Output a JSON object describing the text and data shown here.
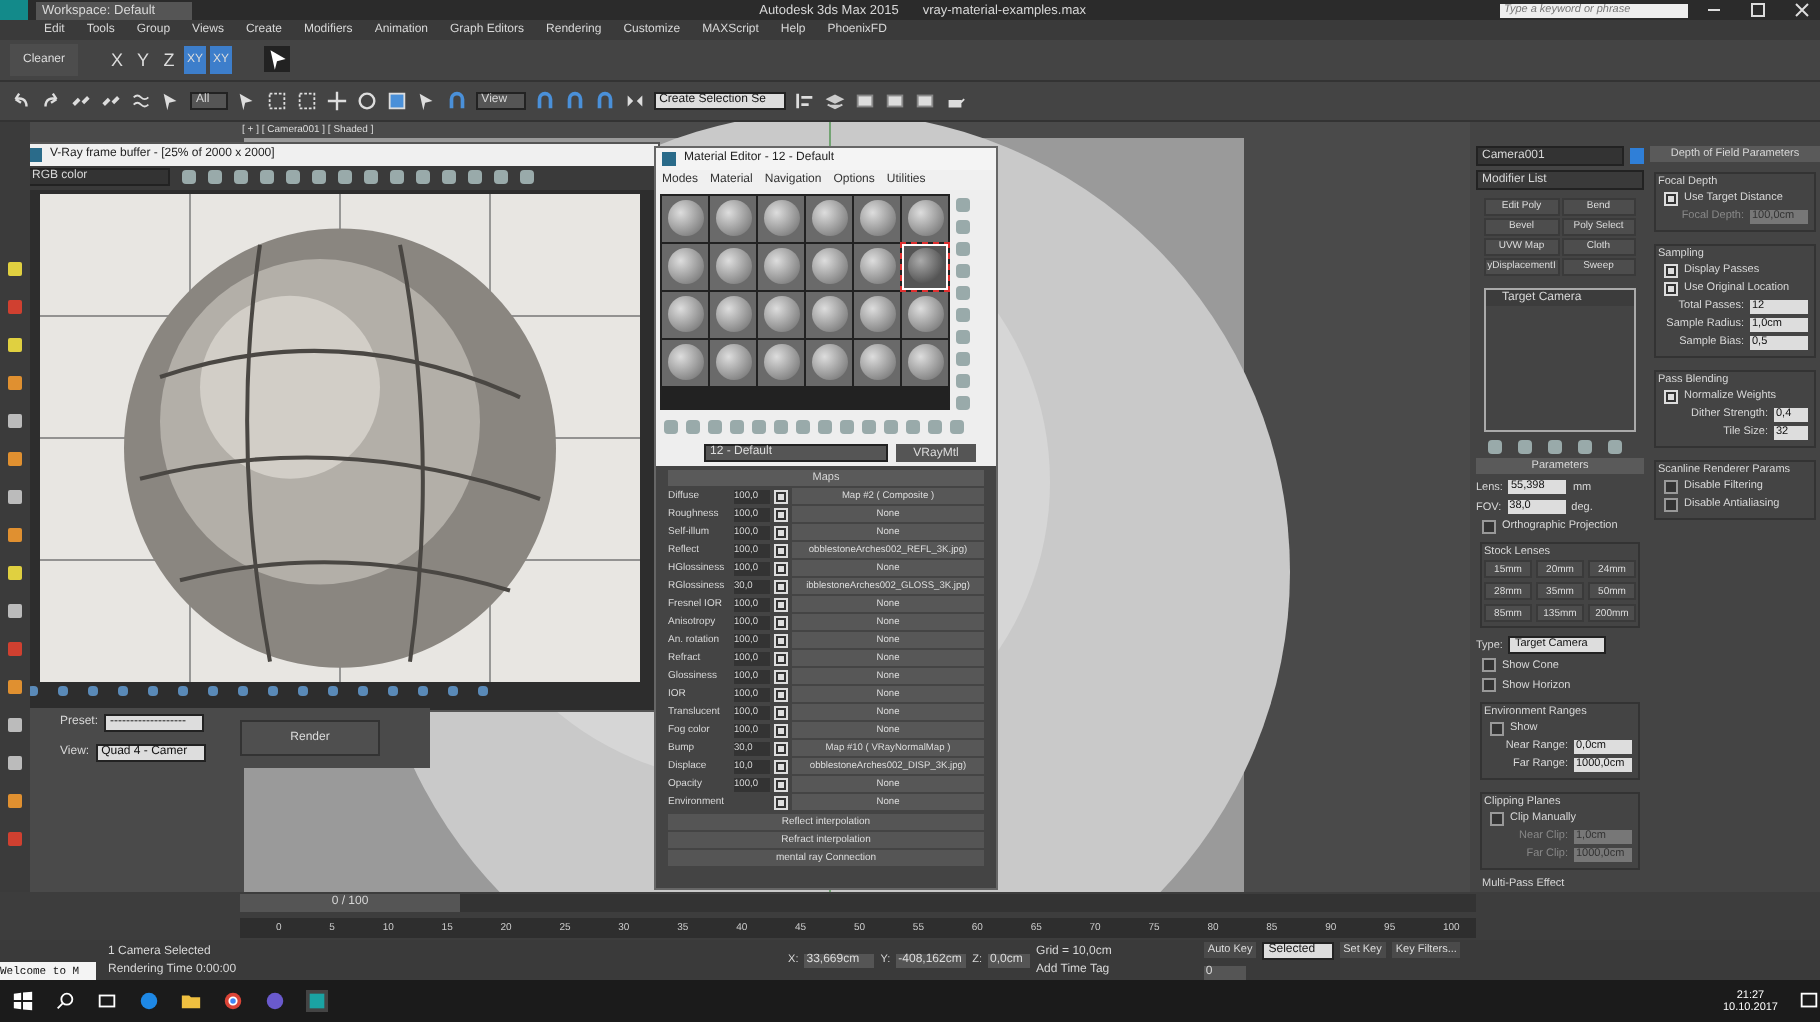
{
  "window": {
    "title": "Autodesk 3ds Max 2015",
    "file": "vray-material-examples.max",
    "workspace": "Workspace: Default",
    "search": {
      "placeholder": "Type a keyword or phrase"
    }
  },
  "menu": [
    "Edit",
    "Tools",
    "Group",
    "Views",
    "Create",
    "Modifiers",
    "Animation",
    "Graph Editors",
    "Rendering",
    "Customize",
    "MAXScript",
    "Help",
    "PhoenixFD"
  ],
  "ribbon": {
    "cleaner": "Cleaner",
    "axes": [
      {
        "label": "X",
        "selected": false
      },
      {
        "label": "Y",
        "selected": false
      },
      {
        "label": "Z",
        "selected": false
      },
      {
        "label": "XY",
        "selected": true
      },
      {
        "label": "XY",
        "selected": true
      }
    ]
  },
  "toolbar": {
    "filter": "All",
    "coord": "View",
    "selection_set": "Create Selection Se"
  },
  "viewport": {
    "label": "[ + ] [ Camera001 ] [ Shaded ]"
  },
  "frame_buffer": {
    "title": "V-Ray frame buffer - [25% of 2000 x 2000]",
    "channel": "RGB color"
  },
  "render_setup": {
    "preset_label": "Preset:",
    "preset": "-------------------",
    "view_label": "View:",
    "view": "Quad 4 - Camer",
    "render": "Render"
  },
  "material_editor": {
    "title": "Material Editor - 12 - Default",
    "menu": [
      "Modes",
      "Material",
      "Navigation",
      "Options",
      "Utilities"
    ],
    "slots": [
      {
        "selected": false
      },
      {
        "selected": false
      },
      {
        "selected": false
      },
      {
        "selected": false
      },
      {
        "selected": false
      },
      {
        "selected": false
      },
      {
        "selected": false
      },
      {
        "selected": false
      },
      {
        "selected": false
      },
      {
        "selected": false
      },
      {
        "selected": false
      },
      {
        "selected": true
      },
      {
        "selected": false
      },
      {
        "selected": false
      },
      {
        "selected": false
      },
      {
        "selected": false
      },
      {
        "selected": false
      },
      {
        "selected": false
      },
      {
        "selected": false
      },
      {
        "selected": false
      },
      {
        "selected": false
      },
      {
        "selected": false
      },
      {
        "selected": false
      },
      {
        "selected": false
      }
    ],
    "material_name": "12 - Default",
    "material_type": "VRayMtl",
    "maps_title": "Maps",
    "maps": [
      {
        "name": "Diffuse",
        "amount": "100,0",
        "checked": true,
        "map": "Map #2  ( Composite )"
      },
      {
        "name": "Roughness",
        "amount": "100,0",
        "checked": true,
        "map": "None"
      },
      {
        "name": "Self-illum",
        "amount": "100,0",
        "checked": true,
        "map": "None"
      },
      {
        "name": "Reflect",
        "amount": "100,0",
        "checked": true,
        "map": "obblestoneArches002_REFL_3K.jpg)"
      },
      {
        "name": "HGlossiness",
        "amount": "100,0",
        "checked": true,
        "map": "None"
      },
      {
        "name": "RGlossiness",
        "amount": "30,0",
        "checked": true,
        "map": "ibblestoneArches002_GLOSS_3K.jpg)"
      },
      {
        "name": "Fresnel IOR",
        "amount": "100,0",
        "checked": true,
        "map": "None"
      },
      {
        "name": "Anisotropy",
        "amount": "100,0",
        "checked": true,
        "map": "None"
      },
      {
        "name": "An. rotation",
        "amount": "100,0",
        "checked": true,
        "map": "None"
      },
      {
        "name": "Refract",
        "amount": "100,0",
        "checked": true,
        "map": "None"
      },
      {
        "name": "Glossiness",
        "amount": "100,0",
        "checked": true,
        "map": "None"
      },
      {
        "name": "IOR",
        "amount": "100,0",
        "checked": true,
        "map": "None"
      },
      {
        "name": "Translucent",
        "amount": "100,0",
        "checked": true,
        "map": "None"
      },
      {
        "name": "Fog color",
        "amount": "100,0",
        "checked": true,
        "map": "None"
      },
      {
        "name": "Bump",
        "amount": "30,0",
        "checked": true,
        "map": "Map #10  ( VRayNormalMap )"
      },
      {
        "name": "Displace",
        "amount": "10,0",
        "checked": true,
        "map": "obblestoneArches002_DISP_3K.jpg)"
      },
      {
        "name": "Opacity",
        "amount": "100,0",
        "checked": true,
        "map": "None"
      },
      {
        "name": "Environment",
        "checked": true,
        "map": "None"
      }
    ],
    "rollouts": [
      "Reflect interpolation",
      "Refract interpolation",
      "mental ray Connection"
    ]
  },
  "command_panel": {
    "object_name": "Camera001",
    "modifier_list": "Modifier List",
    "modifiers": [
      "Edit Poly",
      "Bend",
      "Bevel",
      "Poly Select",
      "UVW Map",
      "Cloth",
      "yDisplacementI",
      "Sweep"
    ],
    "stack": [
      "Target Camera"
    ],
    "parameters_title": "Parameters",
    "lens_label": "Lens:",
    "lens": "55,398",
    "lens_unit": "mm",
    "fov_label": "FOV:",
    "fov": "38,0",
    "fov_unit": "deg.",
    "orthographic": {
      "label": "Orthographic Projection",
      "checked": false
    },
    "stock_title": "Stock Lenses",
    "stock": [
      "15mm",
      "20mm",
      "24mm",
      "28mm",
      "35mm",
      "50mm",
      "85mm",
      "135mm",
      "200mm"
    ],
    "type_label": "Type:",
    "type": "Target Camera",
    "show_cone": {
      "label": "Show Cone",
      "checked": false
    },
    "show_horizon": {
      "label": "Show Horizon",
      "checked": false
    },
    "env_title": "Environment Ranges",
    "env_show": {
      "label": "Show",
      "checked": false
    },
    "near_range_label": "Near Range:",
    "near_range": "0,0cm",
    "far_range_label": "Far Range:",
    "far_range": "1000,0cm",
    "clip_title": "Clipping Planes",
    "clip_manual": {
      "label": "Clip Manually",
      "checked": false
    },
    "near_clip_label": "Near Clip:",
    "near_clip": "1,0cm",
    "far_clip_label": "Far Clip:",
    "far_clip": "1000,0cm",
    "multipass": "Multi-Pass Effect"
  },
  "dof": {
    "title": "Depth of Field Parameters",
    "focal_title": "Focal Depth",
    "use_target": {
      "label": "Use Target Distance",
      "checked": true
    },
    "focal_depth_label": "Focal Depth:",
    "focal_depth": "100,0cm",
    "sampling_title": "Sampling",
    "display_passes": {
      "label": "Display Passes",
      "checked": true
    },
    "use_original": {
      "label": "Use Original Location",
      "checked": true
    },
    "total_passes_label": "Total Passes:",
    "total_passes": "12",
    "sample_radius_label": "Sample Radius:",
    "sample_radius": "1,0cm",
    "sample_bias_label": "Sample Bias:",
    "sample_bias": "0,5",
    "blend_title": "Pass Blending",
    "normalize": {
      "label": "Normalize Weights",
      "checked": true
    },
    "dither_label": "Dither Strength:",
    "dither": "0,4",
    "tile_label": "Tile Size:",
    "tile": "32",
    "scanline_title": "Scanline Renderer Params",
    "disable_filtering": {
      "label": "Disable Filtering",
      "checked": false
    },
    "disable_aa": {
      "label": "Disable Antialiasing",
      "checked": false
    }
  },
  "timeline": {
    "frame": "0 / 100",
    "level": 0,
    "ticks": [
      "0",
      "5",
      "10",
      "15",
      "20",
      "25",
      "30",
      "35",
      "40",
      "45",
      "50",
      "55",
      "60",
      "65",
      "70",
      "75",
      "80",
      "85",
      "90",
      "95",
      "100"
    ]
  },
  "status": {
    "listener": "Welcome to M",
    "selection": "1 Camera Selected",
    "render_time": "Rendering Time  0:00:00",
    "x_label": "X:",
    "x": "33,669cm",
    "y_label": "Y:",
    "y": "-408,162cm",
    "z_label": "Z:",
    "z": "0,0cm",
    "grid": "Grid = 10,0cm",
    "time_tag": "Add Time Tag",
    "auto_key": "Auto Key",
    "key_set": "Selected",
    "set_key": "Set Key",
    "key_filters": "Key Filters...",
    "frame": "0"
  },
  "taskbar": {
    "time": "21:27",
    "date": "10.10.2017"
  }
}
